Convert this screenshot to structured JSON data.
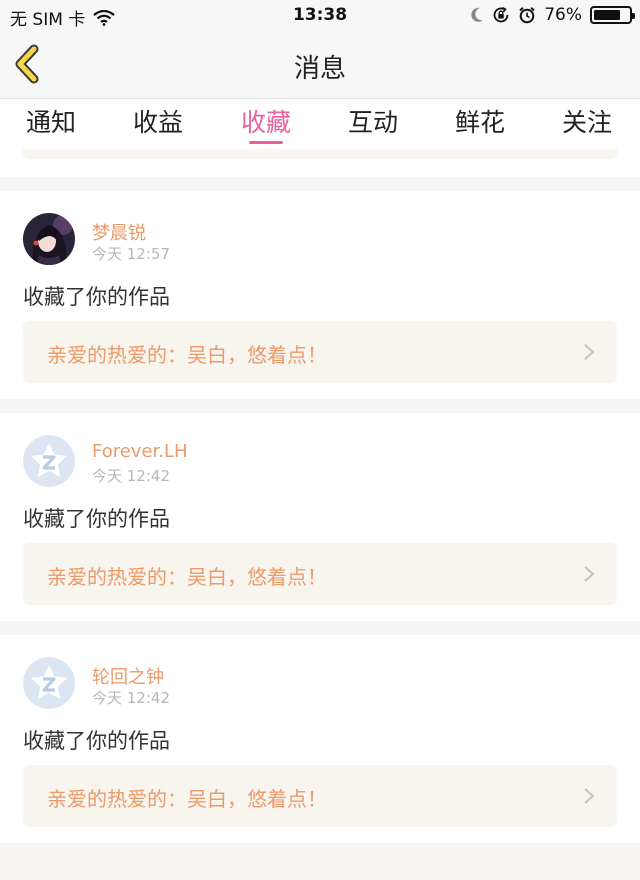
{
  "status_bar": {
    "carrier": "无 SIM 卡",
    "time": "13:38",
    "battery_percent": "76%",
    "battery_level": 0.76,
    "icons": [
      "wifi-icon",
      "moon-icon",
      "rotation-lock-icon",
      "alarm-icon",
      "battery-icon"
    ]
  },
  "nav": {
    "title": "消息",
    "back_icon": "chevron-left-icon"
  },
  "tabs": [
    {
      "label": "通知"
    },
    {
      "label": "收益"
    },
    {
      "label": "收藏"
    },
    {
      "label": "互动"
    },
    {
      "label": "鲜花"
    },
    {
      "label": "关注"
    }
  ],
  "active_tab": "收藏",
  "notifications": [
    {
      "user": "梦晨锐",
      "time": "今天 12:57",
      "action": "收藏了你的作品",
      "work": "亲爱的热爱的：吴白，悠着点！",
      "avatar": "photo"
    },
    {
      "user": "Forever.LH",
      "time": "今天 12:42",
      "action": "收藏了你的作品",
      "work": "亲爱的热爱的：吴白，悠着点！",
      "avatar": "default"
    },
    {
      "user": "轮回之钟",
      "time": "今天 12:42",
      "action": "收藏了你的作品",
      "work": "亲爱的热爱的：吴白，悠着点！",
      "avatar": "default"
    }
  ],
  "colors": {
    "accent_pink": "#e8629b",
    "username_orange": "#ec9a6a",
    "back_arrow_yellow": "#f5d64a",
    "card_link_bg": "#f7f5ee"
  }
}
